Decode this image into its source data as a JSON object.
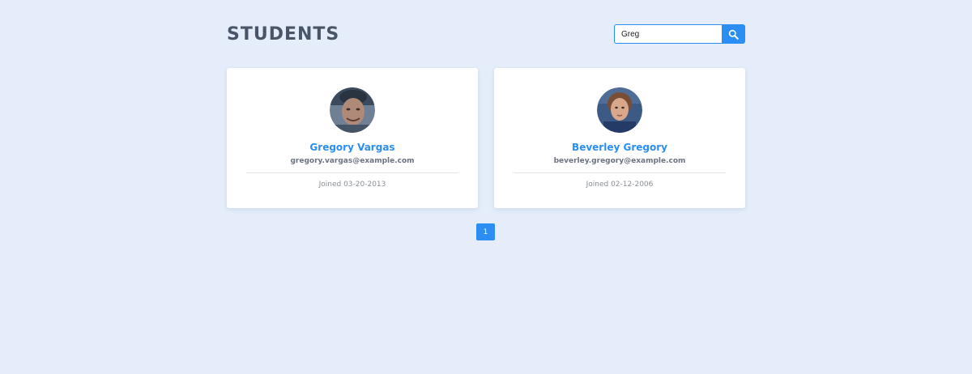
{
  "header": {
    "title": "STUDENTS"
  },
  "search": {
    "value": "Greg",
    "button_icon": "search-icon"
  },
  "students": [
    {
      "name": "Gregory Vargas",
      "email": "gregory.vargas@example.com",
      "joined": "Joined 03-20-2013"
    },
    {
      "name": "Beverley Gregory",
      "email": "beverley.gregory@example.com",
      "joined": "Joined 02-12-2006"
    }
  ],
  "pagination": {
    "pages": [
      "1"
    ],
    "current": "1"
  },
  "colors": {
    "background": "#e4edf9",
    "accent": "#2b8ef2",
    "title": "#4a5568"
  }
}
